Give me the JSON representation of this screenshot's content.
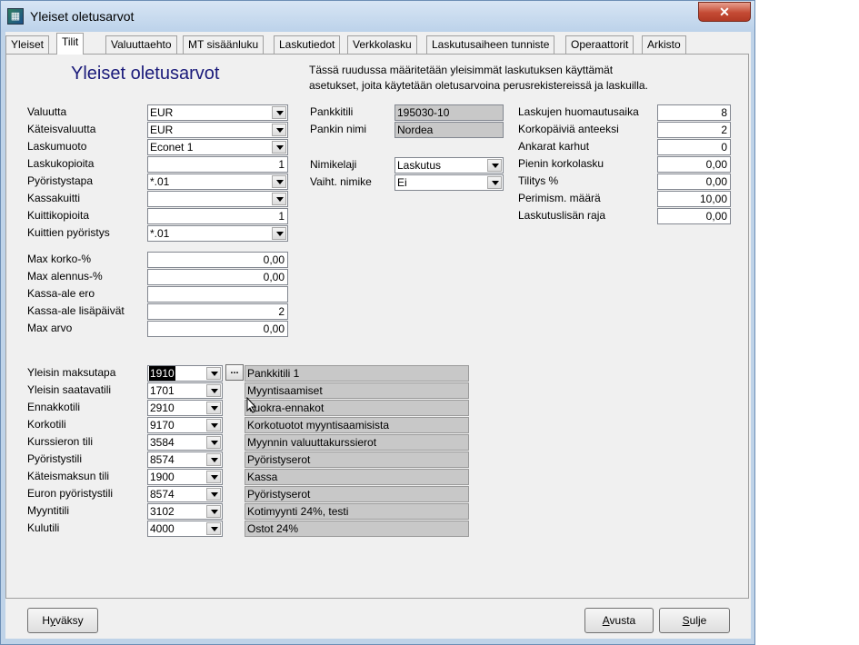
{
  "window": {
    "title": "Yleiset oletusarvot",
    "close_label": "✕"
  },
  "tabs": [
    "Yleiset",
    "Tilit",
    "Valuuttaehto",
    "MT sisäänluku",
    "Laskutiedot",
    "Verkkolasku",
    "Laskutusaiheen tunniste",
    "Operaattorit",
    "Arkisto"
  ],
  "active_tab": "Tilit",
  "panel": {
    "title": "Yleiset oletusarvot",
    "info_line1": "Tässä ruudussa määritetään yleisimmät laskutuksen käyttämät",
    "info_line2": "asetukset, joita käytetään oletusarvoina perusrekistereissä ja laskuilla."
  },
  "left": {
    "valuutta": {
      "label": "Valuutta",
      "value": "EUR"
    },
    "kateisvaluutta": {
      "label": "Käteisvaluutta",
      "value": "EUR"
    },
    "laskumuoto": {
      "label": "Laskumuoto",
      "value": "Econet 1"
    },
    "laskukopioita": {
      "label": "Laskukopioita",
      "value": "1"
    },
    "pyoristystapa": {
      "label": "Pyöristystapa",
      "value": "*.01"
    },
    "kassakuitti": {
      "label": "Kassakuitti",
      "value": ""
    },
    "kuittikopioita": {
      "label": "Kuittikopioita",
      "value": "1"
    },
    "kuittien_pyoristys": {
      "label": "Kuittien pyöristys",
      "value": "*.01"
    },
    "max_korko": {
      "label": "Max korko-%",
      "value": "0,00"
    },
    "max_alennus": {
      "label": "Max alennus-%",
      "value": "0,00"
    },
    "kassa_ale_ero": {
      "label": "Kassa-ale ero",
      "value": ""
    },
    "kassa_ale_lisapaivat": {
      "label": "Kassa-ale lisäpäivät",
      "value": "2"
    },
    "max_arvo": {
      "label": "Max arvo",
      "value": "0,00"
    }
  },
  "middle": {
    "pankkitili": {
      "label": "Pankkitili",
      "value": "195030-10"
    },
    "pankin_nimi": {
      "label": "Pankin nimi",
      "value": "Nordea"
    },
    "nimikelaji": {
      "label": "Nimikelaji",
      "value": "Laskutus"
    },
    "vaiht_nimike": {
      "label": "Vaiht. nimike",
      "value": "Ei"
    }
  },
  "right": {
    "huomautusaika": {
      "label": "Laskujen huomautusaika",
      "value": "8"
    },
    "korkopaivia": {
      "label": "Korkopäiviä anteeksi",
      "value": "2"
    },
    "ankarat_karhut": {
      "label": "Ankarat karhut",
      "value": "0"
    },
    "pienin_korkolasku": {
      "label": "Pienin korkolasku",
      "value": "0,00"
    },
    "tilitys": {
      "label": "Tilitys %",
      "value": "0,00"
    },
    "perimism_maara": {
      "label": "Perimism. määrä",
      "value": "10,00"
    },
    "laskutuslisan_raja": {
      "label": "Laskutuslisän raja",
      "value": "0,00"
    }
  },
  "accounts": [
    {
      "label": "Yleisin maksutapa",
      "code": "1910",
      "name": "Pankkitili 1"
    },
    {
      "label": "Yleisin saatavatili",
      "code": "1701",
      "name": "Myyntisaamiset"
    },
    {
      "label": "Ennakkotili",
      "code": "2910",
      "name": "Vuokra-ennakot"
    },
    {
      "label": "Korkotili",
      "code": "9170",
      "name": "Korkotuotot myyntisaamisista"
    },
    {
      "label": "Kurssieron tili",
      "code": "3584",
      "name": "Myynnin valuuttakurssierot"
    },
    {
      "label": "Pyöristystili",
      "code": "8574",
      "name": "Pyöristyserot"
    },
    {
      "label": "Käteismaksun tili",
      "code": "1900",
      "name": "Kassa"
    },
    {
      "label": "Euron pyöristystili",
      "code": "8574",
      "name": "Pyöristyserot"
    },
    {
      "label": "Myyntitili",
      "code": "3102",
      "name": "Kotimyynti 24%, testi"
    },
    {
      "label": "Kulutili",
      "code": "4000",
      "name": "Ostot 24%"
    }
  ],
  "buttons": {
    "accept_pre": "H",
    "accept_u": "y",
    "accept_post": "väksy",
    "help_pre": "",
    "help_u": "A",
    "help_post": "vusta",
    "close_pre": "",
    "close_u": "S",
    "close_post": "ulje",
    "dots": "..."
  },
  "icons": {
    "app": "app-icon",
    "cursor": "mouse-pointer-icon"
  }
}
